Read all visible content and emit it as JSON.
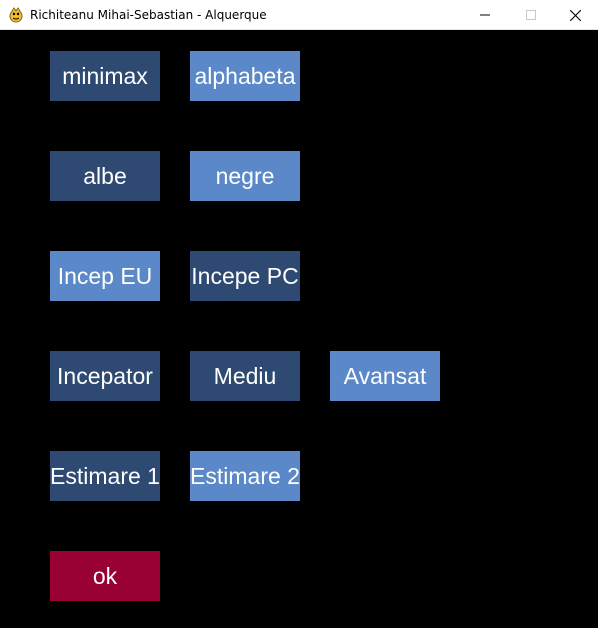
{
  "window": {
    "title": "Richiteanu Mihai-Sebastian - Alquerque",
    "icon": "pygame-snake-icon"
  },
  "colors": {
    "background": "#000000",
    "unselected": "#2e4a73",
    "selected": "#5a88c8",
    "ok": "#990033"
  },
  "buttons": {
    "algorithm": {
      "minimax": "minimax",
      "alphabeta": "alphabeta",
      "selected": "alphabeta"
    },
    "color": {
      "albe": "albe",
      "negre": "negre",
      "selected": "negre"
    },
    "first_player": {
      "me": "Incep EU",
      "pc": "Incepe PC",
      "selected": "Incep EU"
    },
    "difficulty": {
      "beginner": "Incepator",
      "medium": "Mediu",
      "advanced": "Avansat",
      "selected": "Avansat"
    },
    "estimation": {
      "e1": "Estimare 1",
      "e2": "Estimare 2",
      "selected": "Estimare 2"
    },
    "ok": "ok"
  }
}
